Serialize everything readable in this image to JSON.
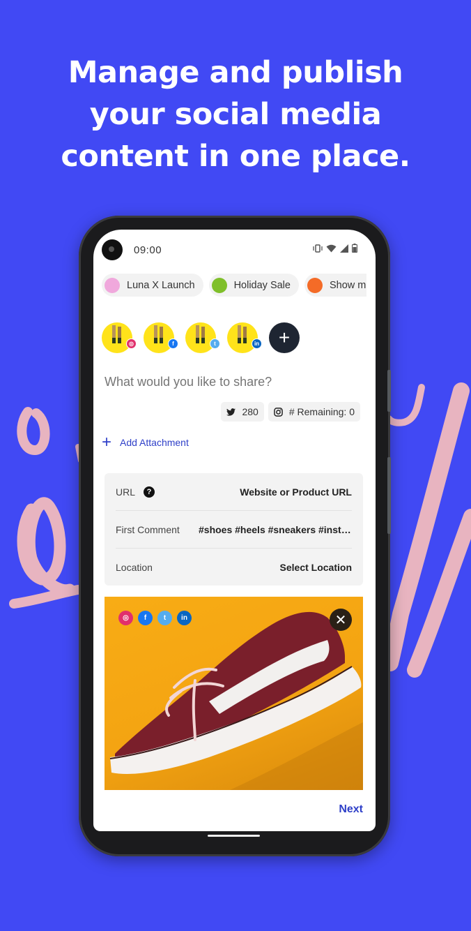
{
  "headline": {
    "lines": [
      "Manage and publish",
      "your social media",
      "content in one place."
    ]
  },
  "colors": {
    "background": "#4149f4",
    "accent": "#2e3fc8",
    "squiggle": "#e8b4c0"
  },
  "status_bar": {
    "time": "09:00",
    "icons": [
      "vibrate-icon",
      "wifi-icon",
      "signal-icon",
      "battery-icon"
    ]
  },
  "campaign_chips": [
    {
      "label": "Luna X Launch",
      "color": "#f0a8dc"
    },
    {
      "label": "Holiday Sale",
      "color": "#7fbf2a"
    },
    {
      "label": "Show me",
      "color": "#f46b27"
    }
  ],
  "accounts": [
    {
      "network": "instagram",
      "badge_color": "#e1306c",
      "badge_glyph": "◎"
    },
    {
      "network": "facebook",
      "badge_color": "#1877f2",
      "badge_glyph": "f"
    },
    {
      "network": "twitter",
      "badge_color": "#55acee",
      "badge_glyph": "t"
    },
    {
      "network": "linkedin",
      "badge_color": "#0a66c2",
      "badge_glyph": "in"
    }
  ],
  "add_account_label": "+",
  "composer": {
    "placeholder": "What would you like to share?",
    "value": ""
  },
  "counters": {
    "twitter": "280",
    "instagram": "# Remaining: 0"
  },
  "add_attachment_label": "Add Attachment",
  "options": [
    {
      "label": "URL",
      "value": "Website or Product URL",
      "help": true
    },
    {
      "label": "First Comment",
      "value": "#shoes #heels #sneakers #instagood",
      "help": false
    },
    {
      "label": "Location",
      "value": "Select Location",
      "help": false
    }
  ],
  "media": {
    "networks": [
      {
        "name": "instagram",
        "color": "#e1306c",
        "glyph": "◎"
      },
      {
        "name": "facebook",
        "color": "#1877f2",
        "glyph": "f"
      },
      {
        "name": "twitter",
        "color": "#55acee",
        "glyph": "t"
      },
      {
        "name": "linkedin",
        "color": "#0a66c2",
        "glyph": "in"
      }
    ],
    "remove_label": "✕"
  },
  "next_label": "Next"
}
